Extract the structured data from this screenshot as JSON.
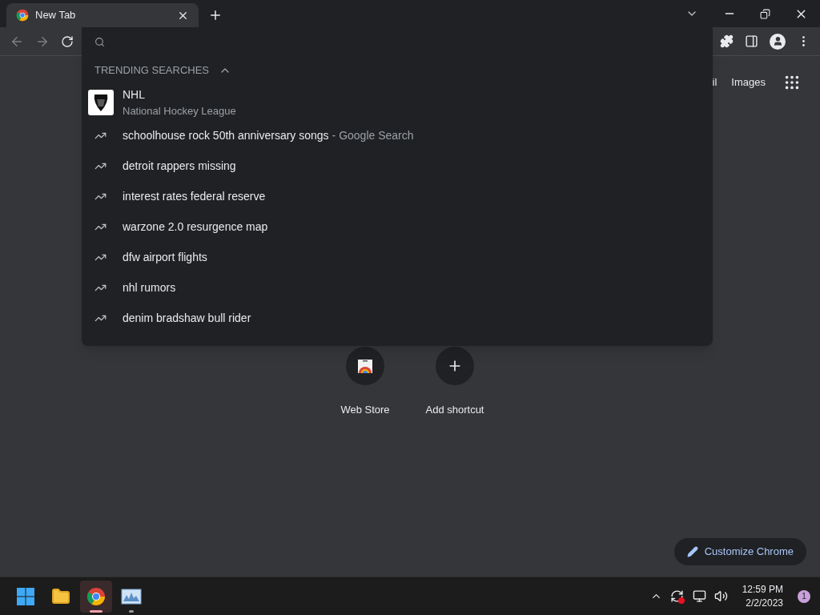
{
  "tabs": [
    {
      "title": "New Tab",
      "selected": true
    }
  ],
  "suggestions": {
    "header": "TRENDING SEARCHES",
    "expanded": true,
    "items": [
      {
        "kind": "entity",
        "text": "NHL",
        "detail": "National Hockey League"
      },
      {
        "kind": "trend",
        "text": "schoolhouse rock 50th anniversary songs",
        "detail": "- Google Search"
      },
      {
        "kind": "trend",
        "text": "detroit rappers missing"
      },
      {
        "kind": "trend",
        "text": "interest rates federal reserve"
      },
      {
        "kind": "trend",
        "text": "warzone 2.0 resurgence map"
      },
      {
        "kind": "trend",
        "text": "dfw airport flights"
      },
      {
        "kind": "trend",
        "text": "nhl rumors"
      },
      {
        "kind": "trend",
        "text": "denim bradshaw bull rider"
      }
    ]
  },
  "header_links": [
    "il",
    "Images"
  ],
  "shortcuts": [
    {
      "kind": "webstore",
      "label": "Web Store"
    },
    {
      "kind": "add",
      "label": "Add shortcut"
    }
  ],
  "customize_button": "Customize Chrome",
  "taskbar": {
    "apps": [
      {
        "kind": "start",
        "selected": false,
        "running": false
      },
      {
        "kind": "files",
        "selected": false,
        "running": false
      },
      {
        "kind": "chrome",
        "selected": true,
        "running": true
      },
      {
        "kind": "monitor",
        "selected": false,
        "running": true
      }
    ],
    "time": "12:59 PM",
    "date": "2/2/2023",
    "notifications": "1"
  }
}
